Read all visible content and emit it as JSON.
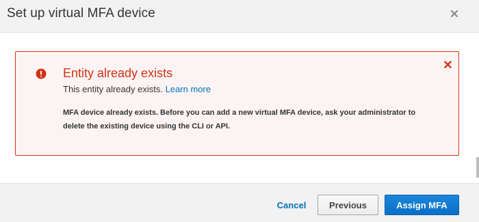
{
  "dialog": {
    "title": "Set up virtual MFA device",
    "close_icon": "close-icon"
  },
  "alert": {
    "icon": "error-icon",
    "dismiss_icon": "dismiss-icon",
    "title": "Entity already exists",
    "subtitle": "This entity already exists.",
    "learn_more": "Learn more",
    "detail": "MFA device already exists. Before you can add a new virtual MFA device, ask your administrator to delete the existing device using the CLI or API.",
    "colors": {
      "error": "#d13212",
      "background": "#fcf4f4",
      "link": "#0073bb"
    }
  },
  "footer": {
    "cancel_label": "Cancel",
    "previous_label": "Previous",
    "assign_label": "Assign MFA",
    "colors": {
      "primary": "#1a7fd4"
    }
  }
}
